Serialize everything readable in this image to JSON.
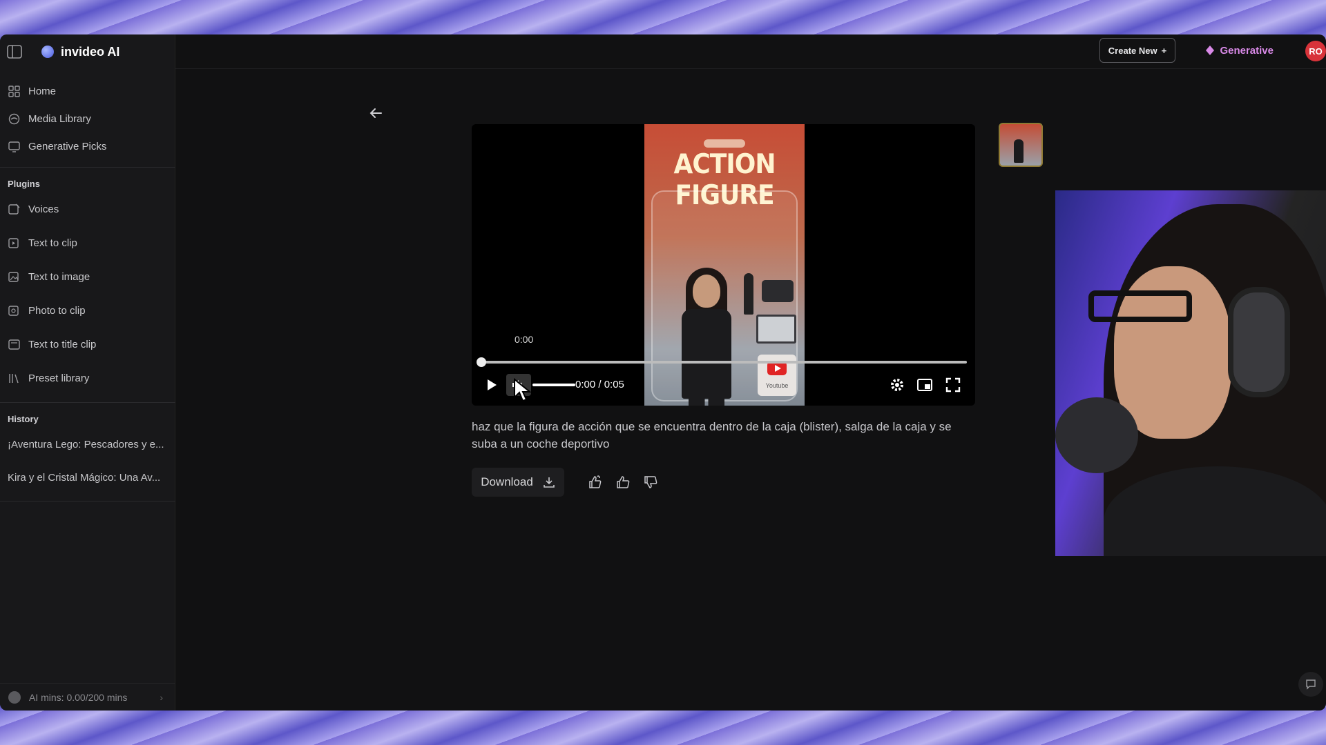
{
  "brand": {
    "name": "invideo AI"
  },
  "nav": {
    "main": [
      {
        "label": "Home",
        "icon": "grid-icon"
      },
      {
        "label": "Media Library",
        "icon": "library-icon"
      },
      {
        "label": "Generative Picks",
        "icon": "picks-icon"
      }
    ],
    "plugins_title": "Plugins",
    "plugins": [
      {
        "label": "Voices",
        "icon": "voice-icon"
      },
      {
        "label": "Text to clip",
        "icon": "text-clip-icon"
      },
      {
        "label": "Text to image",
        "icon": "text-image-icon"
      },
      {
        "label": "Photo to clip",
        "icon": "photo-clip-icon"
      },
      {
        "label": "Text to title clip",
        "icon": "title-clip-icon"
      },
      {
        "label": "Preset library",
        "icon": "preset-icon"
      }
    ],
    "history_title": "History",
    "history": [
      "¡Aventura Lego: Pescadores y e...",
      "Kira y el Cristal Mágico: Una Av..."
    ],
    "ai_mins": "AI mins: 0.00/200 mins"
  },
  "header": {
    "create_label": "Create New",
    "generative_label": "Generative",
    "avatar_initials": "RO"
  },
  "player": {
    "poster_title": "ACTION FIGURE",
    "poster_badge": "Youtube",
    "hover_time": "0:00",
    "time_display": "0:00 / 0:05",
    "progress": 0.0,
    "volume": 1.0
  },
  "prompt": "haz que la figura de acción que se encuentra dentro de la caja (blister), salga de la caja y se suba a un coche deportivo",
  "actions": {
    "download_label": "Download"
  },
  "colors": {
    "accent_generative": "#d98ae8",
    "avatar_bg": "#d8333a",
    "thumb_border": "#8f7a33"
  }
}
